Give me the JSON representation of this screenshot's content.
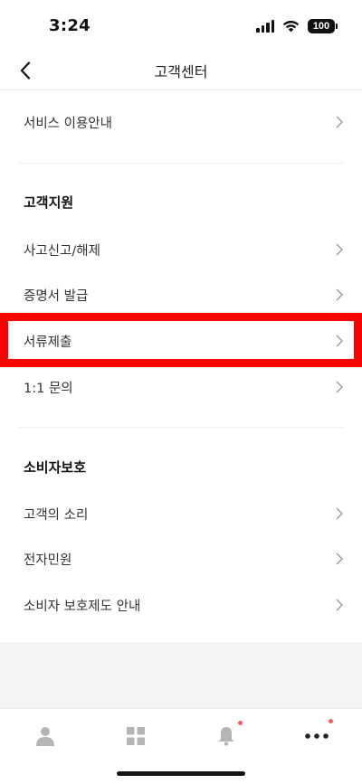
{
  "status": {
    "time": "3:24",
    "battery": "100",
    "icons": [
      "signal-icon",
      "wifi-icon",
      "battery-icon"
    ]
  },
  "header": {
    "title": "고객센터",
    "back_icon": "chevron-left-icon"
  },
  "menu": {
    "service_guide": "서비스 이용안내",
    "support": {
      "heading": "고객지원",
      "items": [
        "사고신고/해제",
        "증명서 발급",
        "서류제출",
        "1:1 문의"
      ]
    },
    "protection": {
      "heading": "소비자보호",
      "items": [
        "고객의 소리",
        "전자민원",
        "소비자 보호제도 안내"
      ]
    }
  },
  "tab_bar": {
    "tabs": [
      {
        "icon": "person-icon",
        "badge": false
      },
      {
        "icon": "grid-icon",
        "badge": false
      },
      {
        "icon": "bell-icon",
        "badge": true
      },
      {
        "icon": "more-icon",
        "badge": true
      }
    ]
  },
  "colors": {
    "highlight": "#ff0000",
    "badge": "#ff5a5a",
    "icon_gray": "#b5b5b5"
  }
}
